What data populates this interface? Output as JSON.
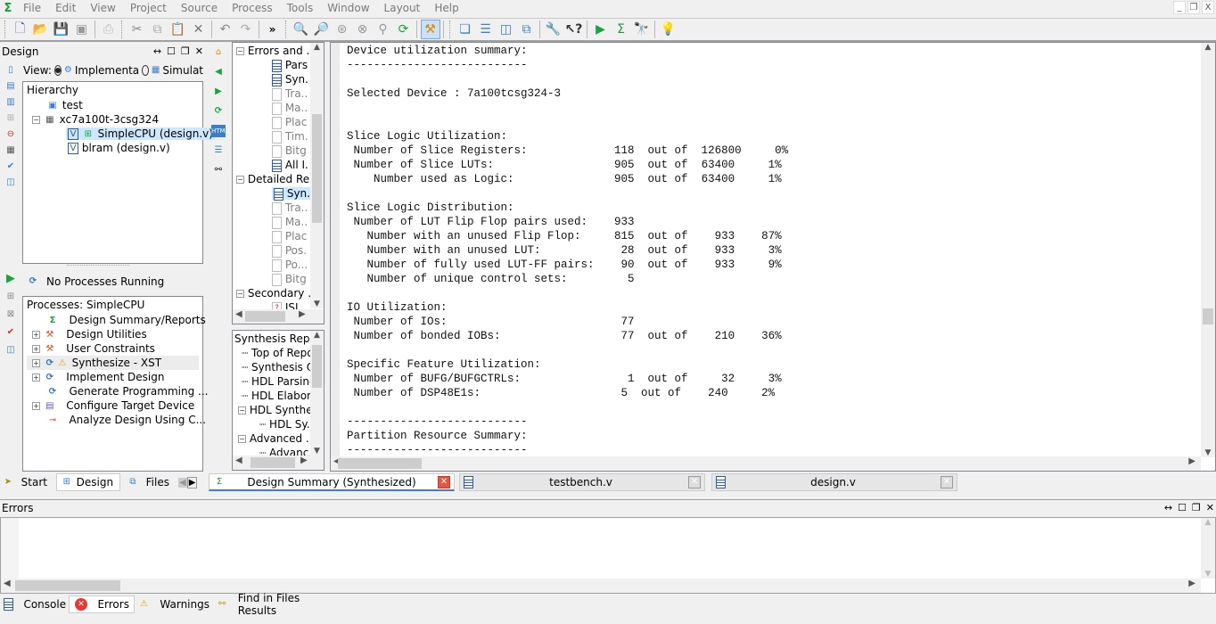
{
  "menubar": {
    "items": [
      "File",
      "Edit",
      "View",
      "Project",
      "Source",
      "Process",
      "Tools",
      "Window",
      "Layout",
      "Help"
    ],
    "window_controls": [
      "minimize",
      "restore",
      "close"
    ]
  },
  "toolbar": {
    "buttons": [
      "new-file",
      "open-project",
      "save",
      "save-all",
      "print",
      "cut",
      "copy",
      "paste",
      "delete",
      "undo",
      "redo",
      "more",
      "zoom-in",
      "zoom-out",
      "zoom-full",
      "zoom-fit",
      "zoom-in-to",
      "refresh",
      "hammer",
      "cascade",
      "tile-horizontal",
      "tile-vertical",
      "new-window",
      "wrench",
      "context-help",
      "run",
      "sigma",
      "binoculars",
      "lightbulb"
    ],
    "overflow_label": "»"
  },
  "design_panel": {
    "title": "Design",
    "view_label": "View:",
    "view_options": [
      {
        "label": "Implementa",
        "selected": true
      },
      {
        "label": "Simulat",
        "selected": false
      }
    ],
    "hierarchy_label": "Hierarchy",
    "hierarchy": [
      {
        "label": "test",
        "level": 1
      },
      {
        "label": "xc7a100t-3csg324",
        "level": 1,
        "expanded": true
      },
      {
        "label": "SimpleCPU (design.v)",
        "level": 2,
        "selected": true
      },
      {
        "label": "blram (design.v)",
        "level": 2
      }
    ],
    "process_status": "No Processes Running",
    "processes_label": "Processes: SimpleCPU",
    "processes": [
      {
        "label": "Design Summary/Reports",
        "expandable": false
      },
      {
        "label": "Design Utilities",
        "expandable": true
      },
      {
        "label": "User Constraints",
        "expandable": true
      },
      {
        "label": "Synthesize - XST",
        "expandable": true,
        "warning": true
      },
      {
        "label": "Implement Design",
        "expandable": true
      },
      {
        "label": "Generate Programming ...",
        "expandable": false
      },
      {
        "label": "Configure Target Device",
        "expandable": true
      },
      {
        "label": "Analyze Design Using C...",
        "expandable": false
      }
    ]
  },
  "summary_nav": {
    "groups": [
      {
        "label": "Errors and ...",
        "items": [
          {
            "label": "Pars",
            "active": true
          },
          {
            "label": "Syn.",
            "active": true
          },
          {
            "label": "Tra..",
            "active": false
          },
          {
            "label": "Ma..",
            "active": false
          },
          {
            "label": "Plac",
            "active": false
          },
          {
            "label": "Tim.",
            "active": false
          },
          {
            "label": "Bitg",
            "active": false
          },
          {
            "label": "All I.",
            "active": true
          }
        ]
      },
      {
        "label": "Detailed Re...",
        "items": [
          {
            "label": "Syn.",
            "active": true,
            "selected": true
          },
          {
            "label": "Tra..",
            "active": false
          },
          {
            "label": "Ma..",
            "active": false
          },
          {
            "label": "Plac",
            "active": false
          },
          {
            "label": "Pos.",
            "active": false
          },
          {
            "label": "Po...",
            "active": false
          },
          {
            "label": "Bitg",
            "active": false
          }
        ]
      },
      {
        "label": "Secondary ..",
        "items": [
          {
            "label": "ISI...",
            "active": true,
            "help": true
          }
        ]
      }
    ]
  },
  "synth_nav": {
    "title": "Synthesis Repor",
    "items": [
      {
        "label": "Top of Repo",
        "level": 1
      },
      {
        "label": "Synthesis O.",
        "level": 1
      },
      {
        "label": "HDL Parsing",
        "level": 1
      },
      {
        "label": "HDL Elabor..",
        "level": 1
      },
      {
        "label": "HDL Synthe.",
        "level": 1,
        "expandable": true
      },
      {
        "label": "HDL Sy..",
        "level": 2
      },
      {
        "label": "Advanced ...",
        "level": 1,
        "expandable": true
      },
      {
        "label": "Advanc.",
        "level": 2
      }
    ]
  },
  "report": {
    "lines": [
      "Device utilization summary:",
      "---------------------------",
      "",
      "Selected Device : 7a100tcsg324-3",
      "",
      "",
      "Slice Logic Utilization:",
      " Number of Slice Registers:             118  out of  126800     0%",
      " Number of Slice LUTs:                  905  out of  63400     1%",
      "    Number used as Logic:               905  out of  63400     1%",
      "",
      "Slice Logic Distribution:",
      " Number of LUT Flip Flop pairs used:    933",
      "   Number with an unused Flip Flop:     815  out of    933    87%",
      "   Number with an unused LUT:            28  out of    933     3%",
      "   Number of fully used LUT-FF pairs:    90  out of    933     9%",
      "   Number of unique control sets:         5",
      "",
      "IO Utilization:",
      " Number of IOs:                          77",
      " Number of bonded IOBs:                  77  out of    210    36%",
      "",
      "Specific Feature Utilization:",
      " Number of BUFG/BUFGCTRLs:                1  out of     32     3%",
      " Number of DSP48E1s:                     5  out of    240     2%",
      "",
      "---------------------------",
      "Partition Resource Summary:",
      "---------------------------"
    ]
  },
  "left_tabs": [
    {
      "label": "Start"
    },
    {
      "label": "Design",
      "active": true
    },
    {
      "label": "Files"
    }
  ],
  "editor_tabs": [
    {
      "label": "Design Summary (Synthesized)",
      "active": true
    },
    {
      "label": "testbench.v",
      "active": false
    },
    {
      "label": "design.v",
      "active": false
    }
  ],
  "errors_panel": {
    "title": "Errors"
  },
  "bottom_tabs": [
    {
      "label": "Console",
      "active": false
    },
    {
      "label": "Errors",
      "active": true
    },
    {
      "label": "Warnings",
      "active": false
    },
    {
      "label": "Find in Files Results",
      "active": false
    }
  ],
  "colors": {
    "accent": "#3c7fc9",
    "warning": "#f2c200",
    "error": "#e53935",
    "run_green": "#1aa33a"
  }
}
